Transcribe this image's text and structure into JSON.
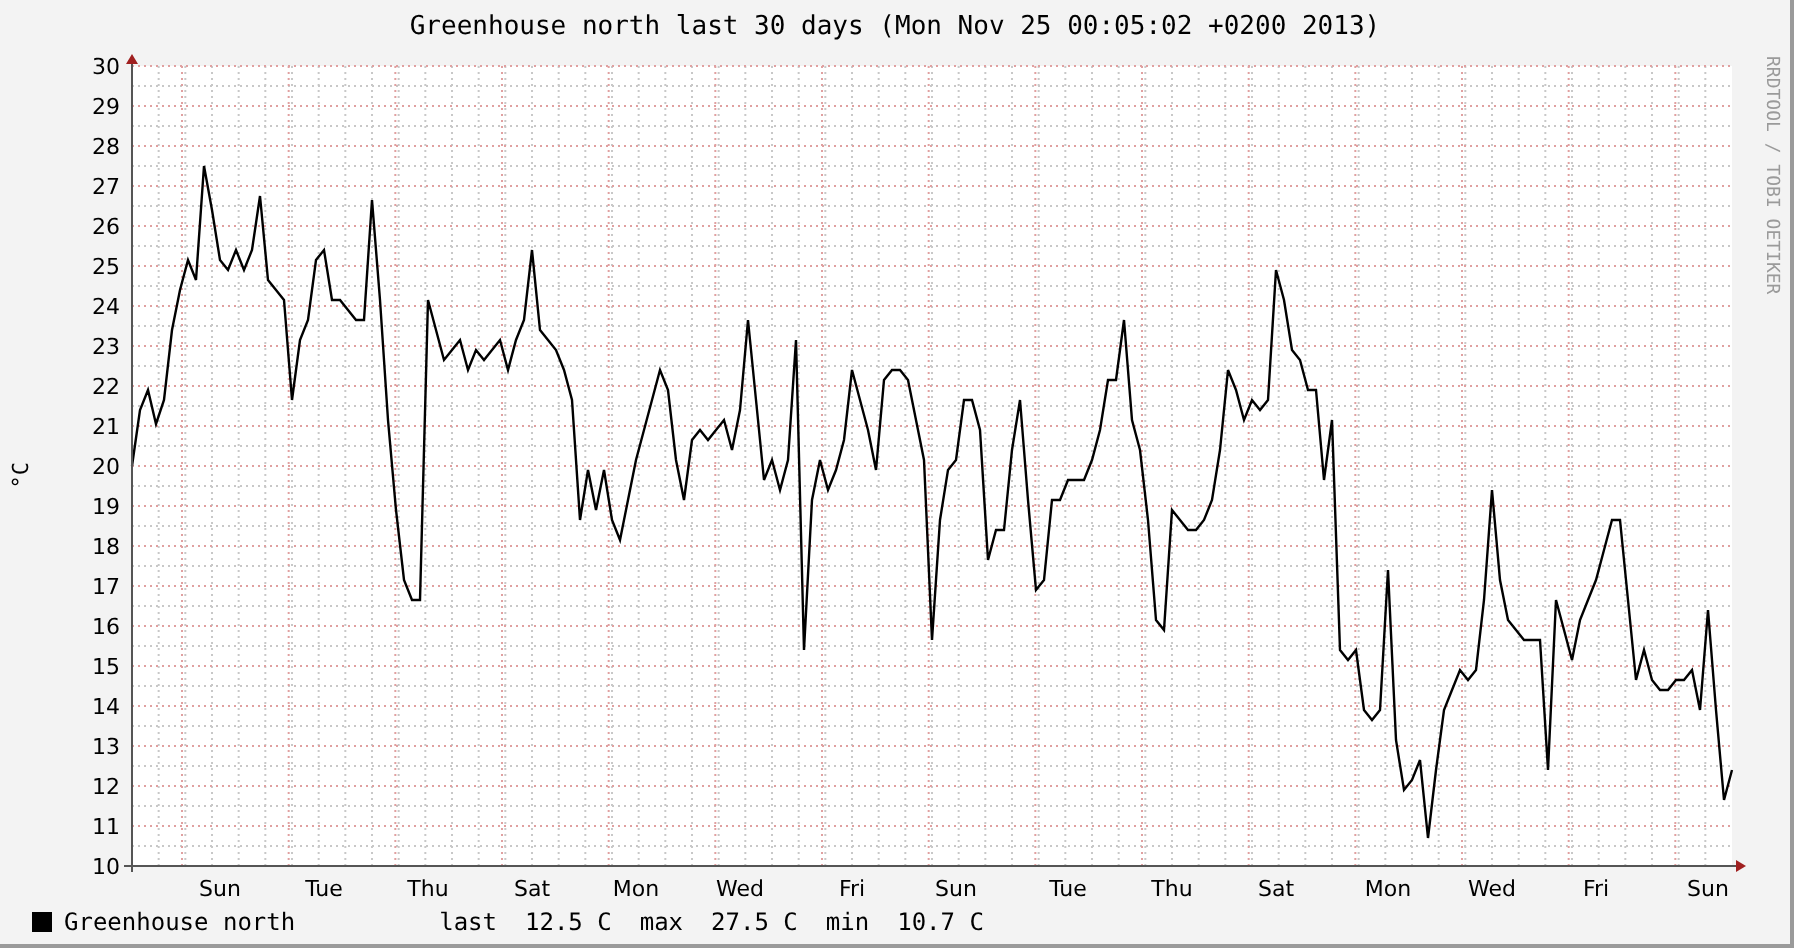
{
  "title": "Greenhouse north last 30 days (Mon Nov 25 00:05:02 +0200 2013)",
  "watermark_side": "RRDTOOL / TOBI OETIKER",
  "chart_data": {
    "type": "line",
    "ylabel": "°C",
    "grid": true,
    "ylim": [
      10,
      30
    ],
    "categories": [
      null,
      null,
      null,
      null,
      null,
      null,
      null,
      null,
      null,
      null,
      null,
      "Sun",
      null,
      null,
      null,
      null,
      null,
      null,
      null,
      null,
      null,
      null,
      null,
      null,
      "Tue",
      null,
      null,
      null,
      null,
      null,
      null,
      null,
      null,
      null,
      null,
      null,
      null,
      "Thu",
      null,
      null,
      null,
      null,
      null,
      null,
      null,
      null,
      null,
      null,
      null,
      null,
      "Sat",
      null,
      null,
      null,
      null,
      null,
      null,
      null,
      null,
      null,
      null,
      null,
      null,
      "Mon",
      null,
      null,
      null,
      null,
      null,
      null,
      null,
      null,
      null,
      null,
      null,
      null,
      "Wed",
      null,
      null,
      null,
      null,
      null,
      null,
      null,
      null,
      null,
      null,
      null,
      null,
      null,
      "Fri",
      null,
      null,
      null,
      null,
      null,
      null,
      null,
      null,
      null,
      null,
      null,
      null,
      "Sun",
      null,
      null,
      null,
      null,
      null,
      null,
      null,
      null,
      null,
      null,
      null,
      null,
      null,
      "Tue",
      null,
      null,
      null,
      null,
      null,
      null,
      null,
      null,
      null,
      null,
      null,
      null,
      "Thu",
      null,
      null,
      null,
      null,
      null,
      null,
      null,
      null,
      null,
      null,
      null,
      null,
      "Sat",
      null,
      null,
      null,
      null,
      null,
      null,
      null,
      null,
      null,
      null,
      null,
      null,
      null,
      "Mon",
      null,
      null,
      null,
      null,
      null,
      null,
      null,
      null,
      null,
      null,
      null,
      null,
      "Wed",
      null,
      null,
      null,
      null,
      null,
      null,
      null,
      null,
      null,
      null,
      null,
      null,
      "Fri",
      null,
      null,
      null,
      null,
      null,
      null,
      null,
      null,
      null,
      null,
      null,
      null,
      null,
      "Sun",
      null,
      null,
      null
    ],
    "yticks": [
      10,
      11,
      12,
      13,
      14,
      15,
      16,
      17,
      18,
      19,
      20,
      21,
      22,
      23,
      24,
      25,
      26,
      27,
      28,
      29,
      30
    ],
    "series": [
      {
        "name": "Greenhouse north",
        "color": "#000000",
        "values": [
          20,
          21.4,
          21.9,
          21.05,
          21.65,
          23.4,
          24.4,
          25.15,
          24.65,
          27.5,
          26.4,
          25.15,
          24.9,
          25.4,
          24.9,
          25.4,
          26.75,
          24.65,
          24.4,
          24.15,
          21.65,
          23.15,
          23.65,
          25.15,
          25.4,
          24.15,
          24.15,
          23.9,
          23.65,
          23.65,
          26.65,
          24.15,
          21.15,
          18.9,
          17.15,
          16.65,
          16.65,
          24.15,
          23.4,
          22.65,
          22.9,
          23.15,
          22.4,
          22.9,
          22.65,
          22.9,
          23.15,
          22.4,
          23.15,
          23.65,
          25.4,
          23.4,
          23.15,
          22.9,
          22.4,
          21.65,
          18.65,
          19.9,
          18.9,
          19.9,
          18.65,
          18.15,
          19.15,
          20.15,
          20.9,
          21.65,
          22.4,
          21.9,
          20.15,
          19.15,
          20.65,
          20.9,
          20.65,
          20.9,
          21.15,
          20.4,
          21.4,
          23.65,
          21.65,
          19.65,
          20.15,
          19.4,
          20.15,
          23.15,
          15.4,
          19.15,
          20.15,
          19.4,
          19.9,
          20.65,
          22.4,
          21.65,
          20.9,
          19.9,
          22.15,
          22.4,
          22.4,
          22.15,
          21.15,
          20.15,
          15.65,
          18.65,
          19.9,
          20.15,
          21.65,
          21.65,
          20.9,
          17.65,
          18.4,
          18.4,
          20.4,
          21.65,
          19.15,
          16.9,
          17.15,
          19.15,
          19.15,
          19.65,
          19.65,
          19.65,
          20.15,
          20.9,
          22.15,
          22.15,
          23.65,
          21.15,
          20.4,
          18.65,
          16.15,
          15.9,
          18.9,
          18.65,
          18.4,
          18.4,
          18.65,
          19.15,
          20.4,
          22.4,
          21.9,
          21.15,
          21.65,
          21.4,
          21.65,
          24.9,
          24.15,
          22.9,
          22.65,
          21.9,
          21.9,
          19.65,
          21.15,
          15.4,
          15.15,
          15.4,
          13.9,
          13.65,
          13.9,
          17.4,
          13.15,
          11.9,
          12.15,
          12.65,
          10.7,
          12.4,
          13.9,
          14.4,
          14.9,
          14.65,
          14.9,
          16.65,
          19.4,
          17.15,
          16.15,
          15.9,
          15.65,
          15.65,
          15.65,
          12.4,
          16.65,
          15.9,
          15.15,
          16.15,
          16.65,
          17.15,
          17.9,
          18.65,
          18.65,
          16.65,
          14.65,
          15.4,
          14.65,
          14.4,
          14.4,
          14.65,
          14.65,
          14.9,
          13.9,
          16.4,
          13.9,
          11.65,
          12.4
        ]
      }
    ]
  },
  "legend": {
    "stats": [
      {
        "label": "last",
        "value": "12.5 C"
      },
      {
        "label": "max",
        "value": "27.5 C"
      },
      {
        "label": "min",
        "value": "10.7 C"
      }
    ]
  }
}
